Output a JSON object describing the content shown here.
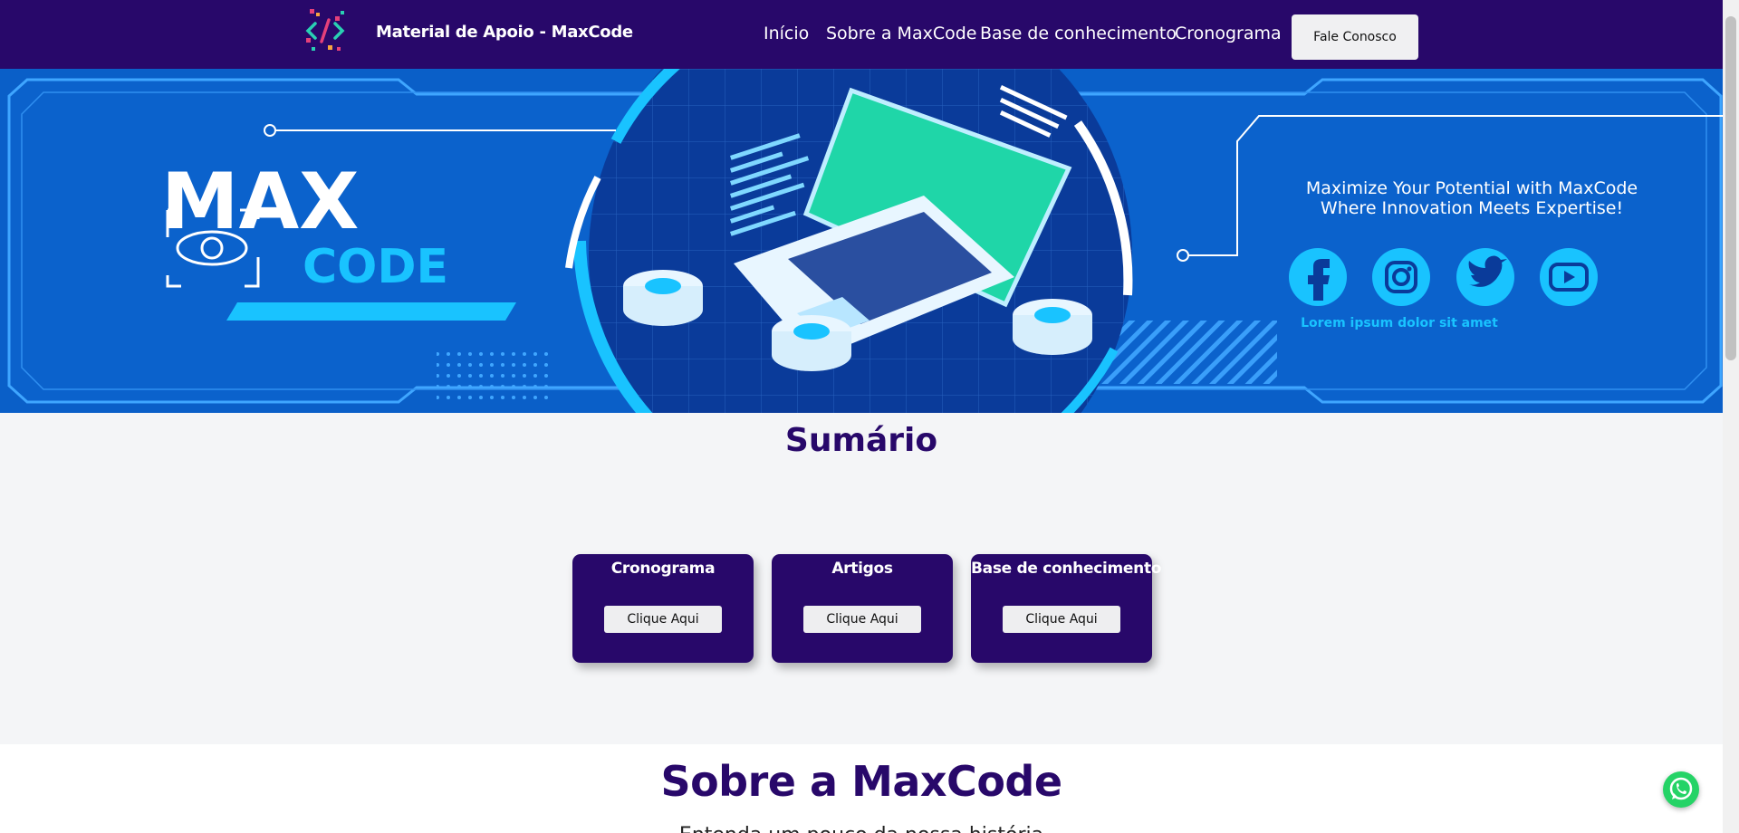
{
  "header": {
    "brand_title": "Material de Apoio - MaxCode",
    "nav": [
      {
        "label": "Início"
      },
      {
        "label": "Sobre a MaxCode"
      },
      {
        "label": "Base de conhecimento"
      },
      {
        "label": "Cronograma"
      }
    ],
    "cta_label": "Fale Conosco"
  },
  "hero": {
    "logo_word1": "MAX",
    "logo_word2": "CODE",
    "tagline_line1": "Maximize Your Potential with MaxCode",
    "tagline_line2": "Where Innovation Meets Expertise!",
    "social_icons": [
      "facebook-icon",
      "instagram-icon",
      "twitter-icon",
      "youtube-icon"
    ],
    "caption": "Lorem ipsum dolor sit amet"
  },
  "summary": {
    "title": "Sumário",
    "cards": [
      {
        "title": "Cronograma",
        "button": "Clique Aqui"
      },
      {
        "title": "Artigos",
        "button": "Clique Aqui"
      },
      {
        "title": "Base de conhecimento",
        "button": "Clique Aqui"
      }
    ]
  },
  "about": {
    "title": "Sobre a MaxCode",
    "text": "Entenda um pouco da nossa história"
  },
  "colors": {
    "brand_purple": "#28086a",
    "hero_blue": "#0a5fc8",
    "accent_cyan": "#19c3ff",
    "screen_green": "#1fd6a8"
  }
}
